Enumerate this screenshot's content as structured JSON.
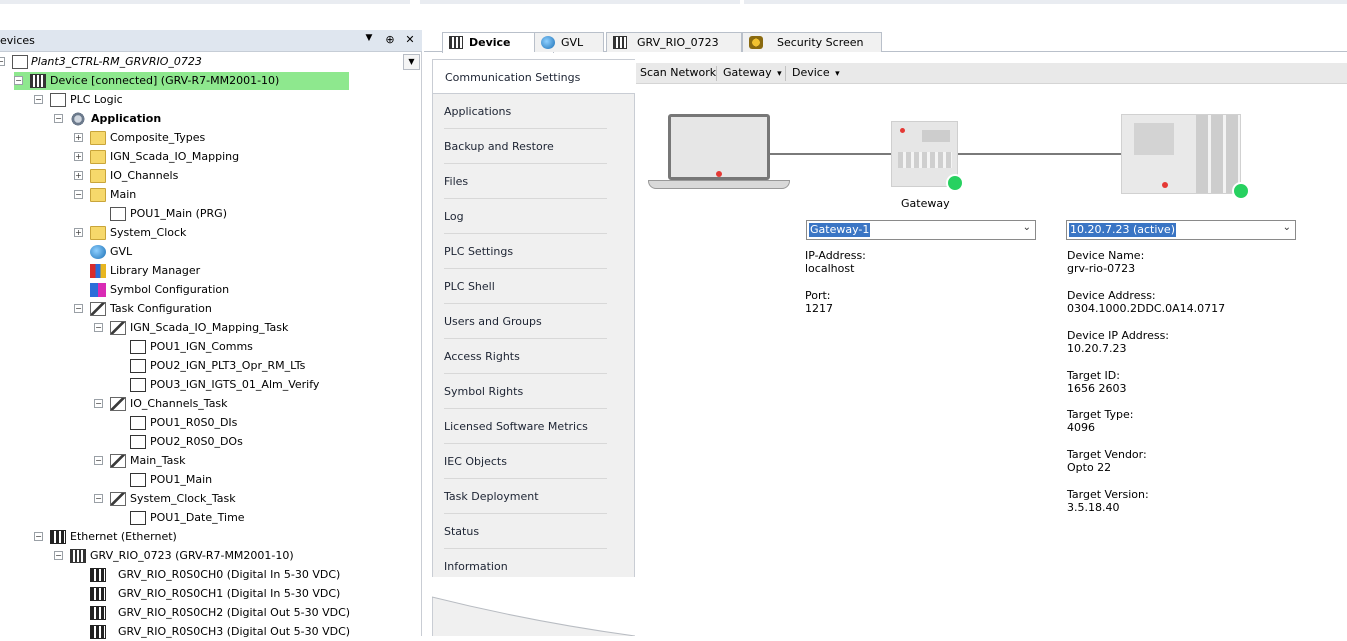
{
  "devices_pane": {
    "title": "evices",
    "menu_arrow": "▼",
    "pin": "⊕",
    "close": "✕",
    "project": "Plant3_CTRL-RM_GRVRIO_0723",
    "tree": [
      {
        "label": "Device [connected] (GRV-R7-MM2001-10)"
      },
      {
        "label": "PLC Logic"
      },
      {
        "label": "Application"
      },
      {
        "label": "Composite_Types"
      },
      {
        "label": "IGN_Scada_IO_Mapping"
      },
      {
        "label": "IO_Channels"
      },
      {
        "label": "Main"
      },
      {
        "label": "POU1_Main (PRG)"
      },
      {
        "label": "System_Clock"
      },
      {
        "label": "GVL"
      },
      {
        "label": "Library Manager"
      },
      {
        "label": "Symbol Configuration"
      },
      {
        "label": "Task Configuration"
      },
      {
        "label": "IGN_Scada_IO_Mapping_Task"
      },
      {
        "label": "POU1_IGN_Comms"
      },
      {
        "label": "POU2_IGN_PLT3_Opr_RM_LTs"
      },
      {
        "label": "POU3_IGN_IGTS_01_Alm_Verify"
      },
      {
        "label": "IO_Channels_Task"
      },
      {
        "label": "POU1_R0S0_DIs"
      },
      {
        "label": "POU2_R0S0_DOs"
      },
      {
        "label": "Main_Task"
      },
      {
        "label": "POU1_Main"
      },
      {
        "label": "System_Clock_Task"
      },
      {
        "label": "POU1_Date_Time"
      },
      {
        "label": "Ethernet (Ethernet)"
      },
      {
        "label": "GRV_RIO_0723 (GRV-R7-MM2001-10)"
      },
      {
        "label": "GRV_RIO_R0S0CH0 (Digital In 5-30 VDC)"
      },
      {
        "label": "GRV_RIO_R0S0CH1 (Digital In 5-30 VDC)"
      },
      {
        "label": "GRV_RIO_R0S0CH2 (Digital Out 5-30 VDC)"
      },
      {
        "label": "GRV_RIO_R0S0CH3 (Digital Out 5-30 VDC)"
      }
    ]
  },
  "tabs": [
    {
      "label": "Device",
      "close": "✕"
    },
    {
      "label": "GVL"
    },
    {
      "label": "GRV_RIO_0723"
    },
    {
      "label": "Security Screen"
    }
  ],
  "settings_menu": [
    "Communication Settings",
    "Applications",
    "Backup and Restore",
    "Files",
    "Log",
    "PLC Settings",
    "PLC Shell",
    "Users and Groups",
    "Access Rights",
    "Symbol Rights",
    "Licensed Software Metrics",
    "IEC Objects",
    "Task Deployment",
    "Status",
    "Information"
  ],
  "toolbar": {
    "scan_network": "Scan Network",
    "gateway": "Gateway",
    "device": "Device",
    "arrow": "▾"
  },
  "gateway": {
    "label": "Gateway",
    "selected": "Gateway-1",
    "ip_label": "IP-Address:",
    "ip_value": "localhost",
    "port_label": "Port:",
    "port_value": "1217"
  },
  "device": {
    "selected": "10.20.7.23 (active)",
    "fields": [
      {
        "label": "Device Name:",
        "value": "grv-rio-0723"
      },
      {
        "label": "Device Address:",
        "value": "0304.1000.2DDC.0A14.0717"
      },
      {
        "label": "Device IP Address:",
        "value": "10.20.7.23"
      },
      {
        "label": "Target ID:",
        "value": "1656  2603"
      },
      {
        "label": "Target Type:",
        "value": "4096"
      },
      {
        "label": "Target Vendor:",
        "value": "Opto 22"
      },
      {
        "label": "Target Version:",
        "value": "3.5.18.40"
      }
    ]
  },
  "colors": {
    "connected_highlight": "#8ee88e",
    "status_green": "#27d160",
    "selection_blue": "#3a75c4"
  }
}
